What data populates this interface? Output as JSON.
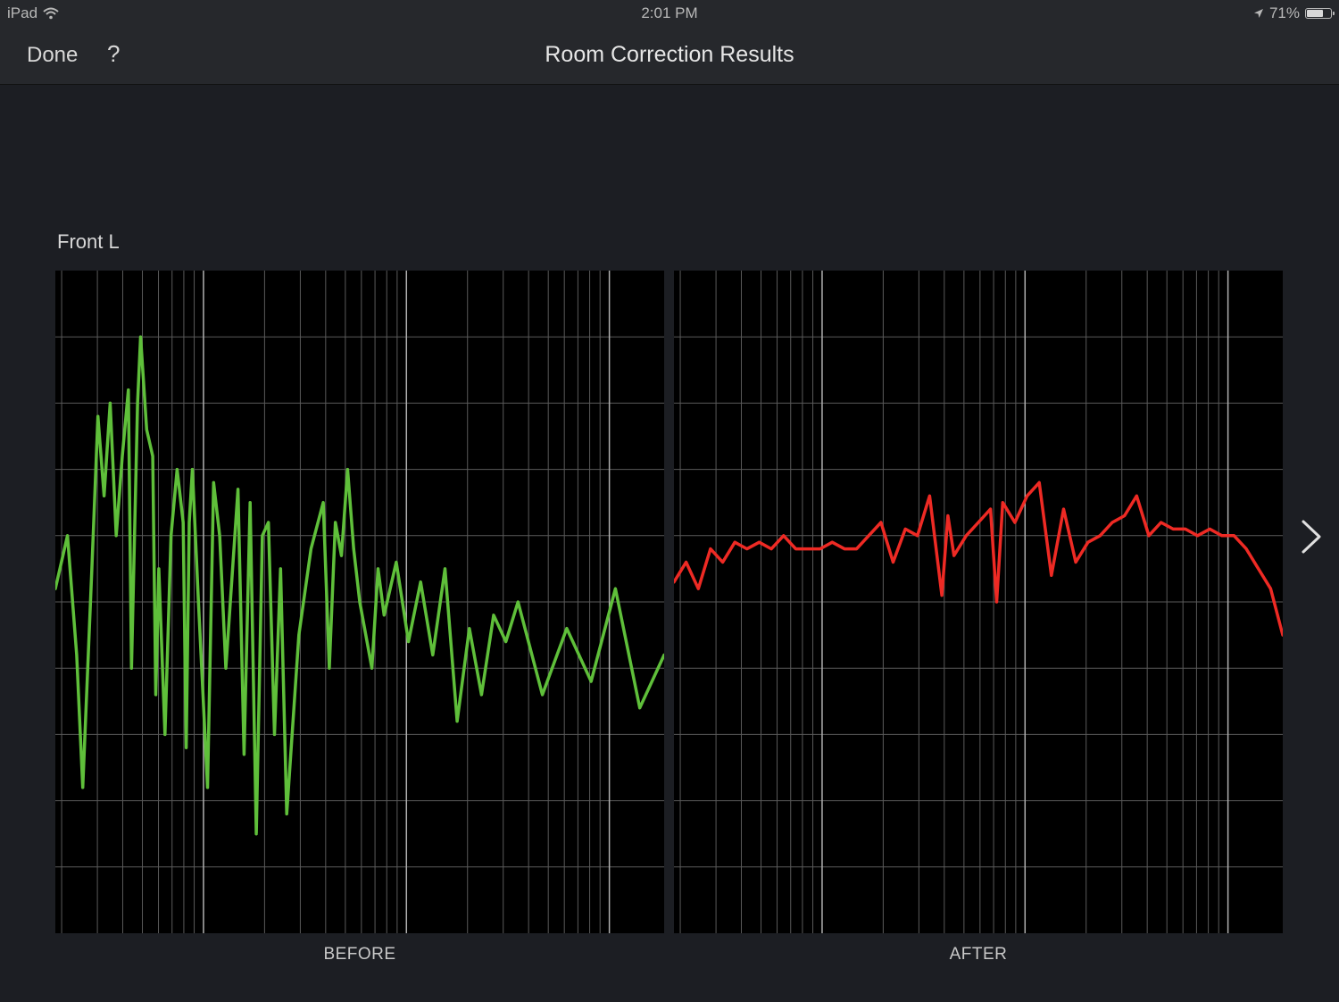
{
  "status_bar": {
    "device": "iPad",
    "time": "2:01 PM",
    "battery": "71%",
    "battery_level": 0.71
  },
  "nav": {
    "done_label": "Done",
    "help_label": "?",
    "title": "Room Correction Results"
  },
  "speaker": "Front L",
  "colors": {
    "before_line": "#5fbf3a",
    "after_line": "#ee2a24",
    "grid": "#5a5a5a",
    "grid_major": "#b0b0b0"
  },
  "chart_data": [
    {
      "type": "line",
      "xlabel": "BEFORE",
      "x_scale": "log",
      "x": [
        0,
        0.02,
        0.035,
        0.045,
        0.06,
        0.07,
        0.08,
        0.09,
        0.1,
        0.11,
        0.12,
        0.125,
        0.135,
        0.14,
        0.15,
        0.16,
        0.165,
        0.17,
        0.18,
        0.19,
        0.2,
        0.21,
        0.215,
        0.22,
        0.225,
        0.235,
        0.25,
        0.26,
        0.27,
        0.28,
        0.3,
        0.31,
        0.32,
        0.33,
        0.34,
        0.35,
        0.36,
        0.37,
        0.38,
        0.4,
        0.42,
        0.44,
        0.45,
        0.46,
        0.47,
        0.48,
        0.49,
        0.5,
        0.52,
        0.53,
        0.54,
        0.56,
        0.58,
        0.6,
        0.62,
        0.64,
        0.66,
        0.68,
        0.7,
        0.72,
        0.74,
        0.76,
        0.8,
        0.84,
        0.88,
        0.92,
        0.96,
        1.0
      ],
      "values": [
        0.52,
        0.6,
        0.42,
        0.22,
        0.55,
        0.78,
        0.66,
        0.8,
        0.6,
        0.72,
        0.82,
        0.4,
        0.8,
        0.9,
        0.76,
        0.72,
        0.36,
        0.55,
        0.3,
        0.6,
        0.7,
        0.62,
        0.28,
        0.62,
        0.7,
        0.5,
        0.22,
        0.68,
        0.6,
        0.4,
        0.67,
        0.27,
        0.65,
        0.15,
        0.6,
        0.62,
        0.3,
        0.55,
        0.18,
        0.45,
        0.58,
        0.65,
        0.4,
        0.62,
        0.57,
        0.7,
        0.58,
        0.5,
        0.4,
        0.55,
        0.48,
        0.56,
        0.44,
        0.53,
        0.42,
        0.55,
        0.32,
        0.46,
        0.36,
        0.48,
        0.44,
        0.5,
        0.36,
        0.46,
        0.38,
        0.52,
        0.34,
        0.42
      ],
      "grid": true
    },
    {
      "type": "line",
      "xlabel": "AFTER",
      "x_scale": "log",
      "x": [
        0,
        0.02,
        0.04,
        0.06,
        0.08,
        0.1,
        0.12,
        0.14,
        0.16,
        0.18,
        0.2,
        0.22,
        0.24,
        0.26,
        0.28,
        0.3,
        0.32,
        0.34,
        0.36,
        0.38,
        0.4,
        0.42,
        0.44,
        0.45,
        0.46,
        0.48,
        0.5,
        0.52,
        0.53,
        0.54,
        0.56,
        0.58,
        0.6,
        0.62,
        0.64,
        0.66,
        0.68,
        0.7,
        0.72,
        0.74,
        0.76,
        0.78,
        0.8,
        0.82,
        0.84,
        0.86,
        0.88,
        0.9,
        0.92,
        0.94,
        0.96,
        0.98,
        1.0
      ],
      "values": [
        0.53,
        0.56,
        0.52,
        0.58,
        0.56,
        0.59,
        0.58,
        0.59,
        0.58,
        0.6,
        0.58,
        0.58,
        0.58,
        0.59,
        0.58,
        0.58,
        0.6,
        0.62,
        0.56,
        0.61,
        0.6,
        0.66,
        0.51,
        0.63,
        0.57,
        0.6,
        0.62,
        0.64,
        0.5,
        0.65,
        0.62,
        0.66,
        0.68,
        0.54,
        0.64,
        0.56,
        0.59,
        0.6,
        0.62,
        0.63,
        0.66,
        0.6,
        0.62,
        0.61,
        0.61,
        0.6,
        0.61,
        0.6,
        0.6,
        0.58,
        0.55,
        0.52,
        0.45
      ],
      "grid": true
    }
  ]
}
